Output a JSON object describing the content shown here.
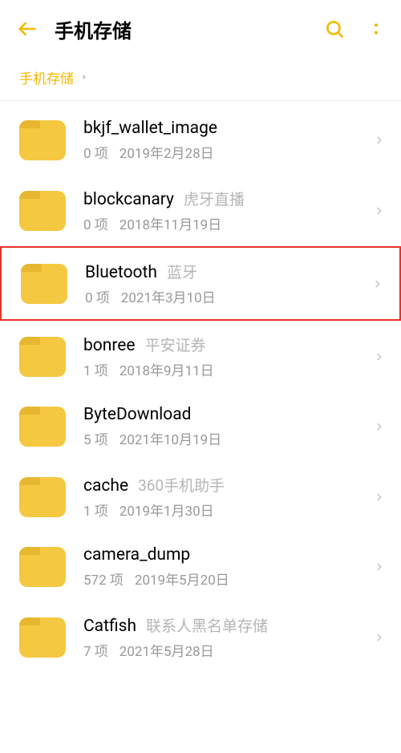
{
  "header": {
    "title": "手机存储"
  },
  "breadcrumb": {
    "current": "手机存储"
  },
  "folders": [
    {
      "name": "bkjf_wallet_image",
      "tag": "",
      "count": "0 项",
      "date": "2019年2月28日",
      "highlighted": false
    },
    {
      "name": "blockcanary",
      "tag": "虎牙直播",
      "count": "0 项",
      "date": "2018年11月19日",
      "highlighted": false
    },
    {
      "name": "Bluetooth",
      "tag": "蓝牙",
      "count": "0 项",
      "date": "2021年3月10日",
      "highlighted": true
    },
    {
      "name": "bonree",
      "tag": "平安证券",
      "count": "1 项",
      "date": "2018年9月11日",
      "highlighted": false
    },
    {
      "name": "ByteDownload",
      "tag": "",
      "count": "5 项",
      "date": "2021年10月19日",
      "highlighted": false
    },
    {
      "name": "cache",
      "tag": "360手机助手",
      "count": "1 项",
      "date": "2019年1月30日",
      "highlighted": false
    },
    {
      "name": "camera_dump",
      "tag": "",
      "count": "572 项",
      "date": "2019年5月20日",
      "highlighted": false
    },
    {
      "name": "Catfish",
      "tag": "联系人黑名单存储",
      "count": "7 项",
      "date": "2021年5月28日",
      "highlighted": false
    }
  ]
}
